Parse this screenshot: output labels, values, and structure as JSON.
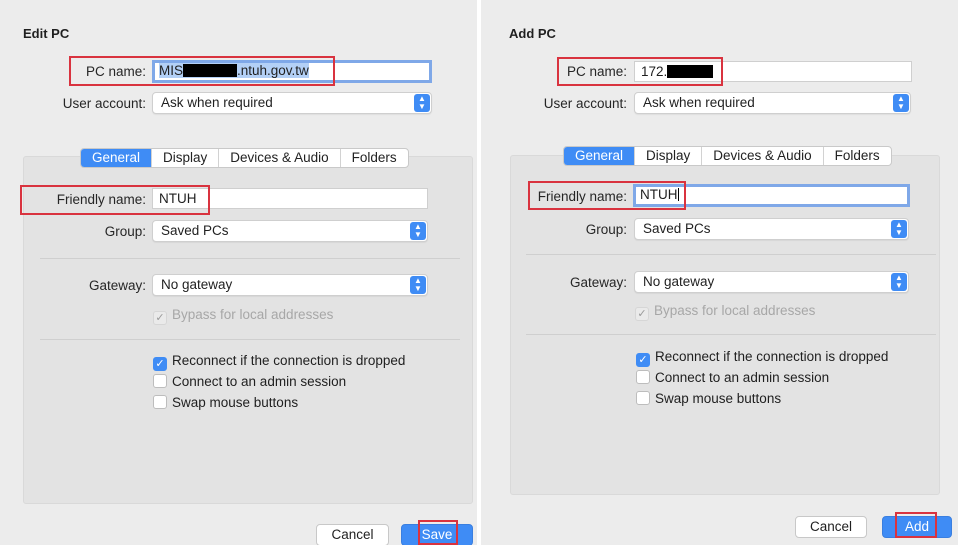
{
  "edit_dialog": {
    "title": "Edit PC",
    "pc_name_label": "PC name:",
    "pc_name_prefix": "MIS",
    "pc_name_suffix": ".ntuh.gov.tw",
    "user_account_label": "User account:",
    "user_account_value": "Ask when required",
    "tabs": [
      "General",
      "Display",
      "Devices & Audio",
      "Folders"
    ],
    "active_tab": "General",
    "friendly_name_label": "Friendly name:",
    "friendly_name_value": "NTUH",
    "group_label": "Group:",
    "group_value": "Saved PCs",
    "gateway_label": "Gateway:",
    "gateway_value": "No gateway",
    "bypass_label": "Bypass for local addresses",
    "options": [
      {
        "label": "Reconnect if the connection is dropped",
        "checked": true
      },
      {
        "label": "Connect to an admin session",
        "checked": false
      },
      {
        "label": "Swap mouse buttons",
        "checked": false
      }
    ],
    "cancel_label": "Cancel",
    "primary_label": "Save"
  },
  "add_dialog": {
    "title": "Add PC",
    "pc_name_label": "PC name:",
    "pc_name_prefix": "172.",
    "user_account_label": "User account:",
    "user_account_value": "Ask when required",
    "tabs": [
      "General",
      "Display",
      "Devices & Audio",
      "Folders"
    ],
    "active_tab": "General",
    "friendly_name_label": "Friendly name:",
    "friendly_name_value": "NTUH",
    "group_label": "Group:",
    "group_value": "Saved PCs",
    "gateway_label": "Gateway:",
    "gateway_value": "No gateway",
    "bypass_label": "Bypass for local addresses",
    "options": [
      {
        "label": "Reconnect if the connection is dropped",
        "checked": true
      },
      {
        "label": "Connect to an admin session",
        "checked": false
      },
      {
        "label": "Swap mouse buttons",
        "checked": false
      }
    ],
    "cancel_label": "Cancel",
    "primary_label": "Add"
  },
  "colors": {
    "accent": "#3f8cf5",
    "highlight_box": "#d9333f",
    "dialog_bg": "#ececec",
    "panel_bg": "#e3e3e3"
  },
  "icons": {
    "popup_arrow": "up-down-chevron-icon",
    "checkmark": "checkmark-icon"
  }
}
